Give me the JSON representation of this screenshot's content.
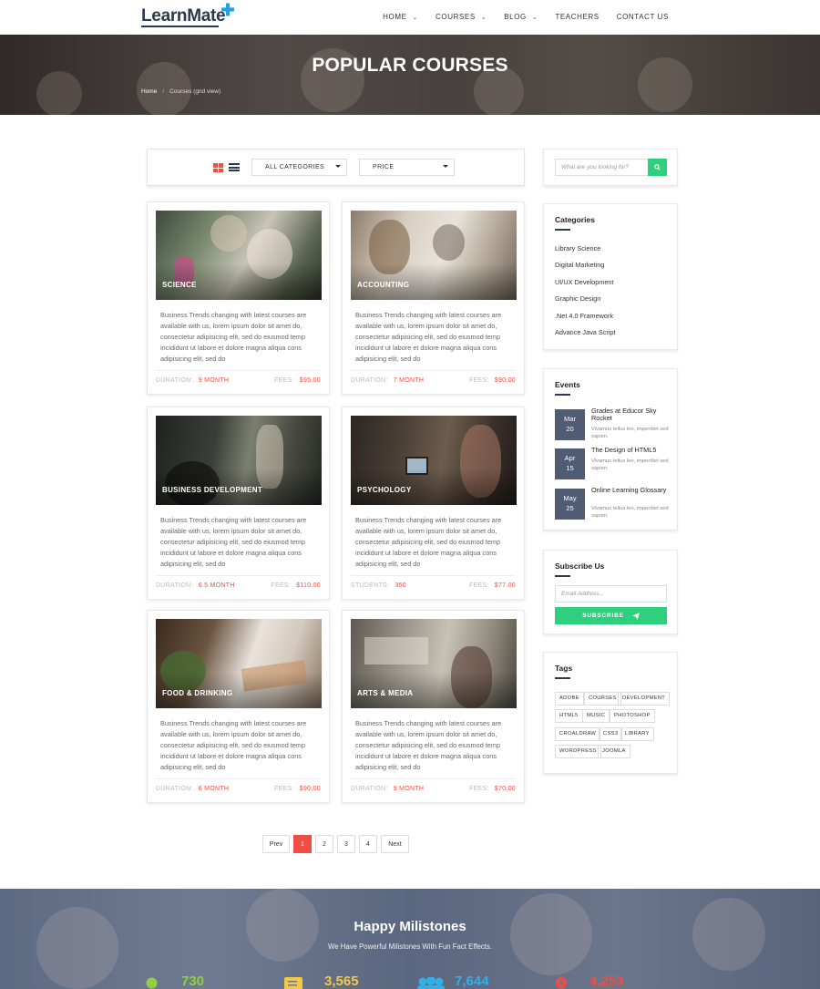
{
  "brand": {
    "logo": "LearnMate"
  },
  "nav": [
    {
      "label": "HOME",
      "dropdown": true
    },
    {
      "label": "COURSES",
      "dropdown": true
    },
    {
      "label": "BLOG",
      "dropdown": true
    },
    {
      "label": "TEACHERS",
      "dropdown": false
    },
    {
      "label": "CONTACT US",
      "dropdown": false
    }
  ],
  "hero": {
    "title": "POPULAR COURSES",
    "breadcrumb": {
      "home": "Home",
      "sep": "/",
      "current": "Courses (grid view)"
    }
  },
  "filter": {
    "category_select": "ALL CATEGORIES",
    "price_select": "PRICE",
    "active_view": "grid"
  },
  "courses": [
    {
      "category": "SCIENCE",
      "description": "Business Trends changing with latest courses are available with us, lorem ipsum dolor sit amet do, consectetur adipisicing elit, sed do eiusmod temp incididunt ut labore et dolore magna aliqua cons adipisicing elit, sed do",
      "left_label": "DURATION:",
      "left_value": "9 MONTH",
      "right_label": "FEES:",
      "right_value": "$95.00"
    },
    {
      "category": "ACCOUNTING",
      "description": "Business Trends changing with latest courses are available with us, lorem ipsum dolor sit amet do, consectetur adipisicing elit, sed do eiusmod temp incididunt ut labore et dolore magna aliqua cons adipisicing elit, sed do",
      "left_label": "DURATION:",
      "left_value": "7 MONTH",
      "right_label": "FEES:",
      "right_value": "$90.00"
    },
    {
      "category": "BUSINESS DEVELOPMENT",
      "description": "Business Trends changing with latest courses are available with us, lorem ipsum dolor sit amet do, consectetur adipisicing elit, sed do eiusmod temp incididunt ut labore et dolore magna aliqua cons adipisicing elit, sed do",
      "left_label": "DURATION:",
      "left_value": "6.5 MONTH",
      "right_label": "FEES:",
      "right_value": "$110.00"
    },
    {
      "category": "PSYCHOLOGY",
      "description": "Business Trends changing with latest courses are available with us, lorem ipsum dolor sit amet do, consectetur adipisicing elit, sed do eiusmod temp incididunt ut labore et dolore magna aliqua cons adipisicing elit, sed do",
      "left_label": "STUDENTS:",
      "left_value": "350",
      "right_label": "FEES:",
      "right_value": "$77.00"
    },
    {
      "category": "FOOD & DRINKING",
      "description": "Business Trends changing with latest courses are available with us, lorem ipsum dolor sit amet do, consectetur adipisicing elit, sed do eiusmod temp incididunt ut labore et dolore magna aliqua cons adipisicing elit, sed do",
      "left_label": "DURATION:",
      "left_value": "6 MONTH",
      "right_label": "FEES:",
      "right_value": "$90.00"
    },
    {
      "category": "ARTS & MEDIA",
      "description": "Business Trends changing with latest courses are available with us, lorem ipsum dolor sit amet do, consectetur adipisicing elit, sed do eiusmod temp incididunt ut labore et dolore magna aliqua cons adipisicing elit, sed do",
      "left_label": "DURATION:",
      "left_value": "9 MONTH",
      "right_label": "FEES:",
      "right_value": "$70.00"
    }
  ],
  "pagination": {
    "prev": "Prev",
    "pages": [
      "1",
      "2",
      "3",
      "4"
    ],
    "active": "1",
    "next": "Next"
  },
  "sidebar": {
    "search": {
      "placeholder": "What are you looking for?"
    },
    "categories": {
      "title": "Categories",
      "items": [
        "Library Science",
        "Digital Marketing",
        "UI/UX Development",
        "Graphic Design",
        ".Net 4.0 Framework",
        "Advance Java Script"
      ]
    },
    "events": {
      "title": "Events",
      "items": [
        {
          "month": "Mar",
          "day": "20",
          "title": "Grades at Educor Sky Rocket",
          "text": "Vivamus tellus leo, imperdiet sed sapien."
        },
        {
          "month": "Apr",
          "day": "15",
          "title": "The Design of HTML5",
          "text": "Vivamus tellus leo, imperdiet sed sapien."
        },
        {
          "month": "May",
          "day": "25",
          "title": "Online Learning Glossary",
          "text": "Vivamus tellus leo, imperdiet sed sapien."
        }
      ]
    },
    "subscribe": {
      "title": "Subscribe Us",
      "placeholder": "Email Address...",
      "button": "SUBSCRIBE"
    },
    "tags": {
      "title": "Tags",
      "items": [
        "ADOBE",
        "COURSES",
        "DEVELOPMENT",
        "HTML5",
        "MUSIC",
        "PHOTOSHOP",
        "CROALDRAW",
        "CSS3",
        "LIBRARY",
        "WORDPRESS",
        "JOOMLA"
      ]
    }
  },
  "milestones": {
    "title": "Happy Milistones",
    "subtitle": "We Have Powerful Milistones With Fun Fact Effects.",
    "counters": [
      {
        "value": "730",
        "color": "#8fd13f",
        "icon": "circle-icon"
      },
      {
        "value": "3,565",
        "color": "#f6c744",
        "icon": "document-icon"
      },
      {
        "value": "7,644",
        "color": "#2fb0e8",
        "icon": "users-icon"
      },
      {
        "value": "4,253",
        "color": "#f04e45",
        "icon": "map-pin-icon"
      }
    ]
  },
  "colors": {
    "accent": "#f04e45",
    "green": "#2ed07e",
    "navy": "#2b3a4e",
    "event_date_bg": "#4f5c74"
  }
}
